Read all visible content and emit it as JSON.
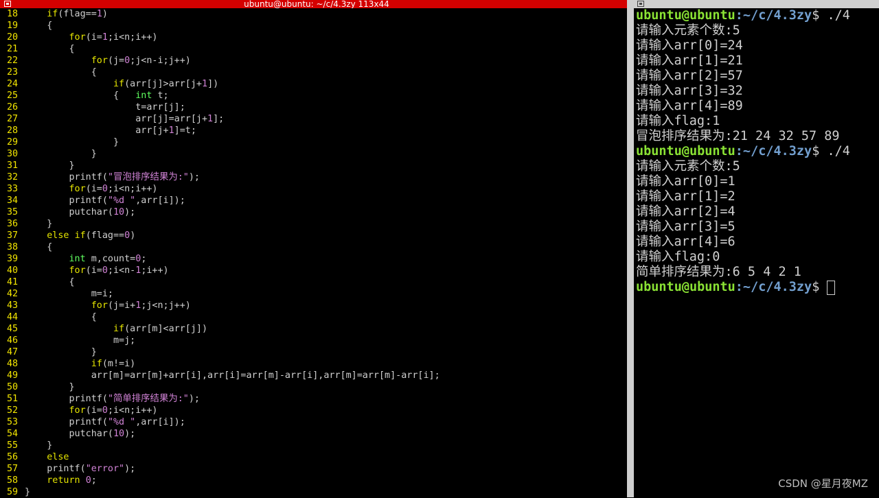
{
  "left_terminal": {
    "title": "ubuntu@ubuntu: ~/c/4.3zy 113x44",
    "code_lines": [
      {
        "num": "18",
        "segs": [
          {
            "t": "    "
          },
          {
            "t": "if",
            "c": "kw"
          },
          {
            "t": "(flag=="
          },
          {
            "t": "1",
            "c": "num"
          },
          {
            "t": ")"
          }
        ]
      },
      {
        "num": "19",
        "segs": [
          {
            "t": "    {"
          }
        ]
      },
      {
        "num": "20",
        "segs": [
          {
            "t": "        "
          },
          {
            "t": "for",
            "c": "kw"
          },
          {
            "t": "(i="
          },
          {
            "t": "1",
            "c": "num"
          },
          {
            "t": ";i<n;i++)"
          }
        ]
      },
      {
        "num": "21",
        "segs": [
          {
            "t": "        {"
          }
        ]
      },
      {
        "num": "22",
        "segs": [
          {
            "t": "            "
          },
          {
            "t": "for",
            "c": "kw"
          },
          {
            "t": "(j="
          },
          {
            "t": "0",
            "c": "num"
          },
          {
            "t": ";j<n-i;j++)"
          }
        ]
      },
      {
        "num": "23",
        "segs": [
          {
            "t": "            {"
          }
        ]
      },
      {
        "num": "24",
        "segs": [
          {
            "t": "                "
          },
          {
            "t": "if",
            "c": "kw"
          },
          {
            "t": "(arr[j]>arr[j+"
          },
          {
            "t": "1",
            "c": "num"
          },
          {
            "t": "])"
          }
        ]
      },
      {
        "num": "25",
        "segs": [
          {
            "t": "                {   "
          },
          {
            "t": "int",
            "c": "typ"
          },
          {
            "t": " t;"
          }
        ]
      },
      {
        "num": "26",
        "segs": [
          {
            "t": "                    t=arr[j];"
          }
        ]
      },
      {
        "num": "27",
        "segs": [
          {
            "t": "                    arr[j]=arr[j+"
          },
          {
            "t": "1",
            "c": "num"
          },
          {
            "t": "];"
          }
        ]
      },
      {
        "num": "28",
        "segs": [
          {
            "t": "                    arr[j+"
          },
          {
            "t": "1",
            "c": "num"
          },
          {
            "t": "]=t;"
          }
        ]
      },
      {
        "num": "29",
        "segs": [
          {
            "t": "                }"
          }
        ]
      },
      {
        "num": "30",
        "segs": [
          {
            "t": "            }"
          }
        ]
      },
      {
        "num": "31",
        "segs": [
          {
            "t": "        }"
          }
        ]
      },
      {
        "num": "32",
        "segs": [
          {
            "t": "        printf("
          },
          {
            "t": "\"冒泡排序结果为:\"",
            "c": "str"
          },
          {
            "t": ");"
          }
        ]
      },
      {
        "num": "33",
        "segs": [
          {
            "t": "        "
          },
          {
            "t": "for",
            "c": "kw"
          },
          {
            "t": "(i="
          },
          {
            "t": "0",
            "c": "num"
          },
          {
            "t": ";i<n;i++)"
          }
        ]
      },
      {
        "num": "34",
        "segs": [
          {
            "t": "        printf("
          },
          {
            "t": "\"%d \"",
            "c": "str"
          },
          {
            "t": ",arr[i]);"
          }
        ]
      },
      {
        "num": "35",
        "segs": [
          {
            "t": "        putchar("
          },
          {
            "t": "10",
            "c": "num"
          },
          {
            "t": ");"
          }
        ]
      },
      {
        "num": "36",
        "segs": [
          {
            "t": "    }"
          }
        ]
      },
      {
        "num": "37",
        "segs": [
          {
            "t": "    "
          },
          {
            "t": "else",
            "c": "kw"
          },
          {
            "t": " "
          },
          {
            "t": "if",
            "c": "kw"
          },
          {
            "t": "(flag=="
          },
          {
            "t": "0",
            "c": "num"
          },
          {
            "t": ")"
          }
        ]
      },
      {
        "num": "38",
        "segs": [
          {
            "t": "    {"
          }
        ]
      },
      {
        "num": "39",
        "segs": [
          {
            "t": "        "
          },
          {
            "t": "int",
            "c": "typ"
          },
          {
            "t": " m,count="
          },
          {
            "t": "0",
            "c": "num"
          },
          {
            "t": ";"
          }
        ]
      },
      {
        "num": "40",
        "segs": [
          {
            "t": "        "
          },
          {
            "t": "for",
            "c": "kw"
          },
          {
            "t": "(i="
          },
          {
            "t": "0",
            "c": "num"
          },
          {
            "t": ";i<n-"
          },
          {
            "t": "1",
            "c": "num"
          },
          {
            "t": ";i++)"
          }
        ]
      },
      {
        "num": "41",
        "segs": [
          {
            "t": "        {"
          }
        ]
      },
      {
        "num": "42",
        "segs": [
          {
            "t": "            m=i;"
          }
        ]
      },
      {
        "num": "43",
        "segs": [
          {
            "t": "            "
          },
          {
            "t": "for",
            "c": "kw"
          },
          {
            "t": "(j=i+"
          },
          {
            "t": "1",
            "c": "num"
          },
          {
            "t": ";j<n;j++)"
          }
        ]
      },
      {
        "num": "44",
        "segs": [
          {
            "t": "            {"
          }
        ]
      },
      {
        "num": "45",
        "segs": [
          {
            "t": "                "
          },
          {
            "t": "if",
            "c": "kw"
          },
          {
            "t": "(arr[m]<arr[j])"
          }
        ]
      },
      {
        "num": "46",
        "segs": [
          {
            "t": "                m=j;"
          }
        ]
      },
      {
        "num": "47",
        "segs": [
          {
            "t": "            }"
          }
        ]
      },
      {
        "num": "48",
        "segs": [
          {
            "t": "            "
          },
          {
            "t": "if",
            "c": "kw"
          },
          {
            "t": "(m!=i)"
          }
        ]
      },
      {
        "num": "49",
        "segs": [
          {
            "t": "            arr[m]=arr[m]+arr[i],arr[i]=arr[m]-arr[i],arr[m]=arr[m]-arr[i];"
          }
        ]
      },
      {
        "num": "50",
        "segs": [
          {
            "t": "        }"
          }
        ]
      },
      {
        "num": "51",
        "segs": [
          {
            "t": "        printf("
          },
          {
            "t": "\"简单排序结果为:\"",
            "c": "str"
          },
          {
            "t": ");"
          }
        ]
      },
      {
        "num": "52",
        "segs": [
          {
            "t": "        "
          },
          {
            "t": "for",
            "c": "kw"
          },
          {
            "t": "(i="
          },
          {
            "t": "0",
            "c": "num"
          },
          {
            "t": ";i<n;i++)"
          }
        ]
      },
      {
        "num": "53",
        "segs": [
          {
            "t": "        printf("
          },
          {
            "t": "\"%d \"",
            "c": "str"
          },
          {
            "t": ",arr[i]);"
          }
        ]
      },
      {
        "num": "54",
        "segs": [
          {
            "t": "        putchar("
          },
          {
            "t": "10",
            "c": "num"
          },
          {
            "t": ");"
          }
        ]
      },
      {
        "num": "55",
        "segs": [
          {
            "t": "    }"
          }
        ]
      },
      {
        "num": "56",
        "segs": [
          {
            "t": "    "
          },
          {
            "t": "else",
            "c": "kw"
          }
        ]
      },
      {
        "num": "57",
        "segs": [
          {
            "t": "    printf("
          },
          {
            "t": "\"error\"",
            "c": "str"
          },
          {
            "t": ");"
          }
        ]
      },
      {
        "num": "58",
        "segs": [
          {
            "t": "    "
          },
          {
            "t": "return",
            "c": "kw"
          },
          {
            "t": " "
          },
          {
            "t": "0",
            "c": "num"
          },
          {
            "t": ";"
          }
        ]
      },
      {
        "num": "59",
        "segs": [
          {
            "t": "}"
          }
        ]
      }
    ]
  },
  "right_terminal": {
    "prompt_user": "ubuntu@ubuntu",
    "prompt_path": ":~/c/4.3zy",
    "prompt_symbol": "$",
    "lines": [
      {
        "type": "prompt",
        "cmd": " ./4"
      },
      {
        "type": "out",
        "text": "请输入元素个数:5"
      },
      {
        "type": "out",
        "text": "请输入arr[0]=24"
      },
      {
        "type": "out",
        "text": "请输入arr[1]=21"
      },
      {
        "type": "out",
        "text": "请输入arr[2]=57"
      },
      {
        "type": "out",
        "text": "请输入arr[3]=32"
      },
      {
        "type": "out",
        "text": "请输入arr[4]=89"
      },
      {
        "type": "out",
        "text": "请输入flag:1"
      },
      {
        "type": "out",
        "text": "冒泡排序结果为:21 24 32 57 89"
      },
      {
        "type": "prompt",
        "cmd": " ./4"
      },
      {
        "type": "out",
        "text": "请输入元素个数:5"
      },
      {
        "type": "out",
        "text": "请输入arr[0]=1"
      },
      {
        "type": "out",
        "text": "请输入arr[1]=2"
      },
      {
        "type": "out",
        "text": "请输入arr[2]=4"
      },
      {
        "type": "out",
        "text": "请输入arr[3]=5"
      },
      {
        "type": "out",
        "text": "请输入arr[4]=6"
      },
      {
        "type": "out",
        "text": "请输入flag:0"
      },
      {
        "type": "out",
        "text": "简单排序结果为:6 5 4 2 1"
      },
      {
        "type": "prompt",
        "cmd": " ",
        "cursor": true
      }
    ]
  },
  "watermark": "CSDN @星月夜MZ"
}
